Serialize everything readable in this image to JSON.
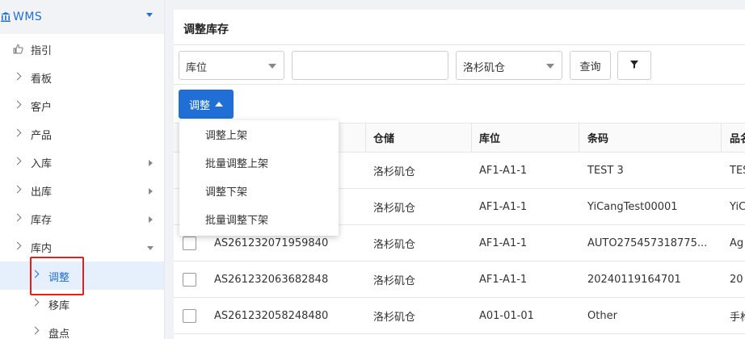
{
  "sidebar": {
    "app_title": "WMS",
    "items": [
      {
        "label": "指引"
      },
      {
        "label": "看板"
      },
      {
        "label": "客户"
      },
      {
        "label": "产品"
      },
      {
        "label": "入库"
      },
      {
        "label": "出库"
      },
      {
        "label": "库存"
      },
      {
        "label": "库内"
      }
    ],
    "sub_items": [
      {
        "label": "调整",
        "active": true
      },
      {
        "label": "移库"
      },
      {
        "label": "盘点"
      }
    ]
  },
  "main": {
    "title": "调整库存",
    "filters": {
      "field_select": "库位",
      "warehouse_select": "洛杉矶仓",
      "query_label": "查询"
    },
    "adjust_button": "调整",
    "menu": [
      "调整上架",
      "批量调整上架",
      "调整下架",
      "批量调整下架"
    ],
    "table": {
      "headers": [
        "",
        "",
        "仓储",
        "库位",
        "条码",
        "品名"
      ],
      "rows": [
        {
          "no": "",
          "warehouse": "洛杉矶仓",
          "location": "AF1-A1-1",
          "barcode": "TEST 3",
          "name": "TES"
        },
        {
          "no": "",
          "warehouse": "洛杉矶仓",
          "location": "AF1-A1-1",
          "barcode": "YiCangTest00001",
          "name": "YiC"
        },
        {
          "no": "AS261232071959840",
          "warehouse": "洛杉矶仓",
          "location": "AF1-A1-1",
          "barcode": "AUTO275457318775...",
          "name": "Ag"
        },
        {
          "no": "AS261232063682848",
          "warehouse": "洛杉矶仓",
          "location": "AF1-A1-1",
          "barcode": "20240119164701",
          "name": "20"
        },
        {
          "no": "AS261232058248480",
          "warehouse": "洛杉矶仓",
          "location": "A01-01-01",
          "barcode": "Other",
          "name": "手枪"
        }
      ]
    }
  },
  "colors": {
    "accent": "#1f6fd6",
    "highlight": "#e0201d"
  }
}
